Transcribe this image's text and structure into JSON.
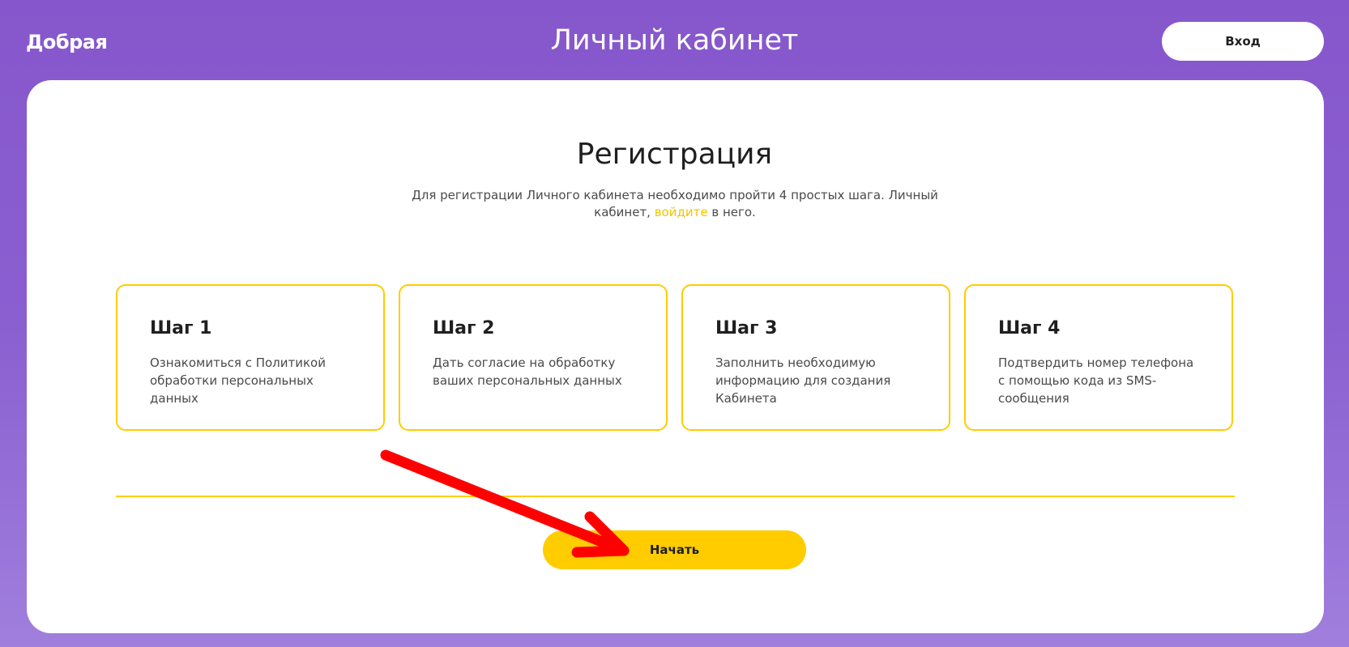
{
  "header": {
    "logo_text": "Добрая",
    "title": "Личный кабинет",
    "login_label": "Вход"
  },
  "registration": {
    "title": "Регистрация",
    "description_before": "Для регистрации Личного кабинета необходимо пройти 4 простых шага. Личный кабинет, ",
    "description_link": "войдите",
    "description_after": " в него."
  },
  "steps": [
    {
      "title": "Шаг 1",
      "text": "Ознакомиться с Политикой обработки персональных данных"
    },
    {
      "title": "Шаг 2",
      "text": "Дать согласие на обработку ваших персональных данных"
    },
    {
      "title": "Шаг 3",
      "text": "Заполнить необходимую информацию для создания Кабинета"
    },
    {
      "title": "Шаг 4",
      "text": "Подтвердить номер телефона с помощью кода из SMS-сообщения"
    }
  ],
  "actions": {
    "start_label": "Начать"
  },
  "colors": {
    "brand_purple": "#8657cc",
    "accent_yellow": "#ffcc00",
    "annotation_red": "#ff0000"
  },
  "icons": {
    "annotation": "red-arrow-icon"
  }
}
